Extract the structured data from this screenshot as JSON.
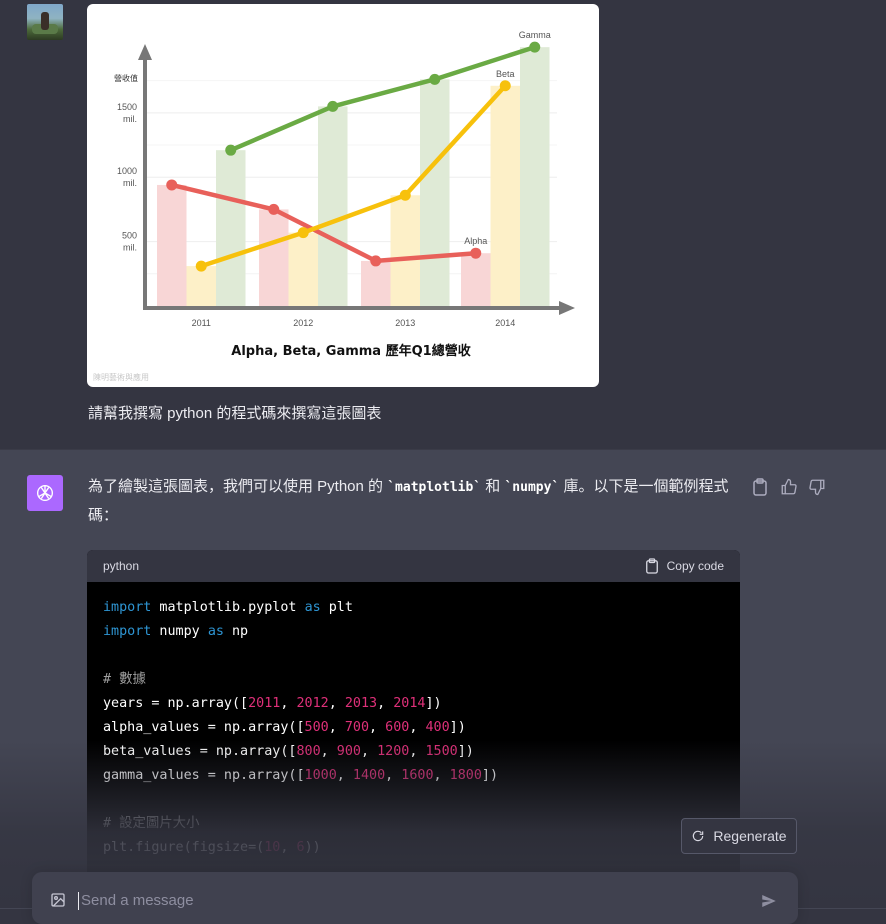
{
  "user": {
    "avatar": "user-avatar-photo",
    "message": "請幫我撰寫 python 的程式碼來撰寫這張圖表"
  },
  "chart_data": {
    "type": "bar+line",
    "title": "Alpha, Beta, Gamma 歷年Q1總營收",
    "ylabel": "營收值",
    "categories": [
      "2011",
      "2012",
      "2013",
      "2014"
    ],
    "ytick_labels": [
      {
        "value": 500,
        "line1": "500",
        "line2": "mil."
      },
      {
        "value": 1000,
        "line1": "1000",
        "line2": "mil."
      },
      {
        "value": 1500,
        "line1": "1500",
        "line2": "mil."
      }
    ],
    "ylim": [
      0,
      2050
    ],
    "series": [
      {
        "name": "Alpha",
        "color": "#e8605a",
        "bar_color": "#f8d6d6",
        "values": [
          940,
          750,
          350,
          410
        ]
      },
      {
        "name": "Beta",
        "color": "#f7c10c",
        "bar_color": "#fdf0c8",
        "values": [
          310,
          570,
          860,
          1710
        ]
      },
      {
        "name": "Gamma",
        "color": "#6aaa44",
        "bar_color": "#dfead6",
        "values": [
          1210,
          1550,
          1760,
          2010
        ]
      }
    ],
    "watermark": "陳明藝術與應用"
  },
  "assistant": {
    "avatar": "chatgpt-logo",
    "intro_1": "為了繪製這張圖表，我們可以使用 Python 的 ",
    "lib_1": "`matplotlib`",
    "intro_2": " 和 ",
    "lib_2": "`numpy`",
    "intro_3": " 庫。以下是一個範例程式碼：",
    "actions": [
      "clipboard-icon",
      "thumbs-up-icon",
      "thumbs-down-icon"
    ]
  },
  "code_block": {
    "language": "python",
    "copy_label": "Copy code",
    "lines": [
      [
        [
          "kw",
          "import"
        ],
        [
          "p",
          " matplotlib.pyplot "
        ],
        [
          "kw",
          "as"
        ],
        [
          "p",
          " plt"
        ]
      ],
      [
        [
          "kw",
          "import"
        ],
        [
          "p",
          " numpy "
        ],
        [
          "kw",
          "as"
        ],
        [
          "p",
          " np"
        ]
      ],
      [],
      [
        [
          "cm",
          "# 數據"
        ]
      ],
      [
        [
          "p",
          "years = np.array(["
        ],
        [
          "num",
          "2011"
        ],
        [
          "p",
          ", "
        ],
        [
          "num",
          "2012"
        ],
        [
          "p",
          ", "
        ],
        [
          "num",
          "2013"
        ],
        [
          "p",
          ", "
        ],
        [
          "num",
          "2014"
        ],
        [
          "p",
          "])"
        ]
      ],
      [
        [
          "p",
          "alpha_values = np.array(["
        ],
        [
          "num",
          "500"
        ],
        [
          "p",
          ", "
        ],
        [
          "num",
          "700"
        ],
        [
          "p",
          ", "
        ],
        [
          "num",
          "600"
        ],
        [
          "p",
          ", "
        ],
        [
          "num",
          "400"
        ],
        [
          "p",
          "])"
        ]
      ],
      [
        [
          "p",
          "beta_values = np.array(["
        ],
        [
          "num",
          "800"
        ],
        [
          "p",
          ", "
        ],
        [
          "num",
          "900"
        ],
        [
          "p",
          ", "
        ],
        [
          "num",
          "1200"
        ],
        [
          "p",
          ", "
        ],
        [
          "num",
          "1500"
        ],
        [
          "p",
          "])"
        ]
      ],
      [
        [
          "p",
          "gamma_values = np.array(["
        ],
        [
          "num",
          "1000"
        ],
        [
          "p",
          ", "
        ],
        [
          "num",
          "1400"
        ],
        [
          "p",
          ", "
        ],
        [
          "num",
          "1600"
        ],
        [
          "p",
          ", "
        ],
        [
          "num",
          "1800"
        ],
        [
          "p",
          "])"
        ]
      ],
      [],
      [
        [
          "cm",
          "# 設定圖片大小"
        ]
      ],
      [
        [
          "p",
          "plt.figure(figsize=("
        ],
        [
          "num",
          "10"
        ],
        [
          "p",
          ", "
        ],
        [
          "num",
          "6"
        ],
        [
          "p",
          "))"
        ]
      ]
    ]
  },
  "regenerate_label": "Regenerate",
  "input": {
    "placeholder": "Send a message"
  }
}
